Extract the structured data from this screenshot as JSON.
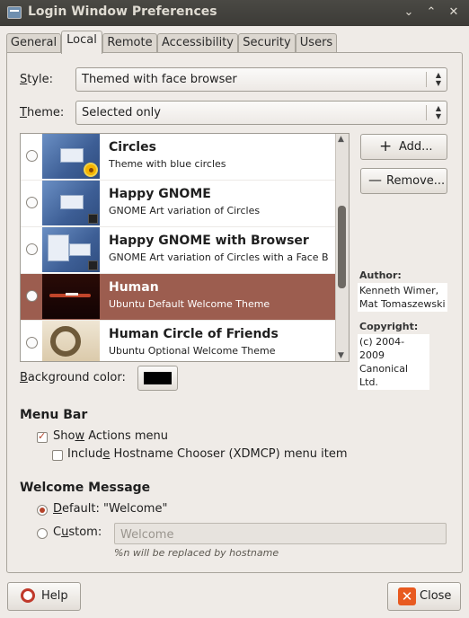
{
  "window": {
    "title": "Login Window Preferences",
    "controls": [
      "⌄",
      "⌃",
      "✕"
    ]
  },
  "tabs": [
    {
      "label": "General"
    },
    {
      "label": "Local",
      "active": true
    },
    {
      "label": "Remote"
    },
    {
      "label": "Accessibility"
    },
    {
      "label": "Security"
    },
    {
      "label": "Users"
    }
  ],
  "style": {
    "label_pre": "",
    "label_u": "S",
    "label_post": "tyle:",
    "value": "Themed with face browser"
  },
  "theme": {
    "label_u": "T",
    "label_post": "heme:",
    "value": "Selected only"
  },
  "themes": [
    {
      "name": "Circles",
      "desc": "Theme with blue circles",
      "thumb": "blue-flower"
    },
    {
      "name": "Happy GNOME",
      "desc": "GNOME Art variation of Circles",
      "thumb": "blue"
    },
    {
      "name": "Happy GNOME with Browser",
      "desc": "GNOME Art variation of Circles with a Face B",
      "thumb": "browser"
    },
    {
      "name": "Human",
      "desc": "Ubuntu Default Welcome Theme",
      "thumb": "human",
      "selected": true
    },
    {
      "name": "Human Circle of Friends",
      "desc": "Ubuntu Optional Welcome Theme",
      "thumb": "cof"
    }
  ],
  "buttons": {
    "add": "Add...",
    "remove": "Remove...",
    "help": "Help",
    "close": "Close"
  },
  "author": {
    "heading": "Author:",
    "value_line1": "Kenneth Wimer,",
    "value_line2": "Mat Tomaszewski"
  },
  "copyright": {
    "heading": "Copyright:",
    "value_line1": "(c) 2004-2009",
    "value_line2": "Canonical Ltd."
  },
  "background": {
    "label_u": "B",
    "label_post": "ackground color:",
    "color": "#000000"
  },
  "menubar": {
    "heading": "Menu Bar",
    "show_actions": {
      "label_pre": "Sho",
      "label_u": "w",
      "label_post": " Actions menu",
      "checked": true
    },
    "include_host": {
      "label_pre": "Includ",
      "label_u": "e",
      "label_post": " Hostname Chooser (XDMCP) menu item",
      "checked": false
    }
  },
  "welcome": {
    "heading": "Welcome Message",
    "default": {
      "label_u": "D",
      "label_post": "efault: \"Welcome\"",
      "selected": true
    },
    "custom": {
      "label_pre": "C",
      "label_u": "u",
      "label_post": "stom:",
      "placeholder": "Welcome",
      "selected": false
    },
    "hint": "%n will be replaced by hostname"
  },
  "colors": {
    "accent": "#b4432a",
    "selection": "#9c5d4f",
    "titlebar": "#3c3b37"
  }
}
